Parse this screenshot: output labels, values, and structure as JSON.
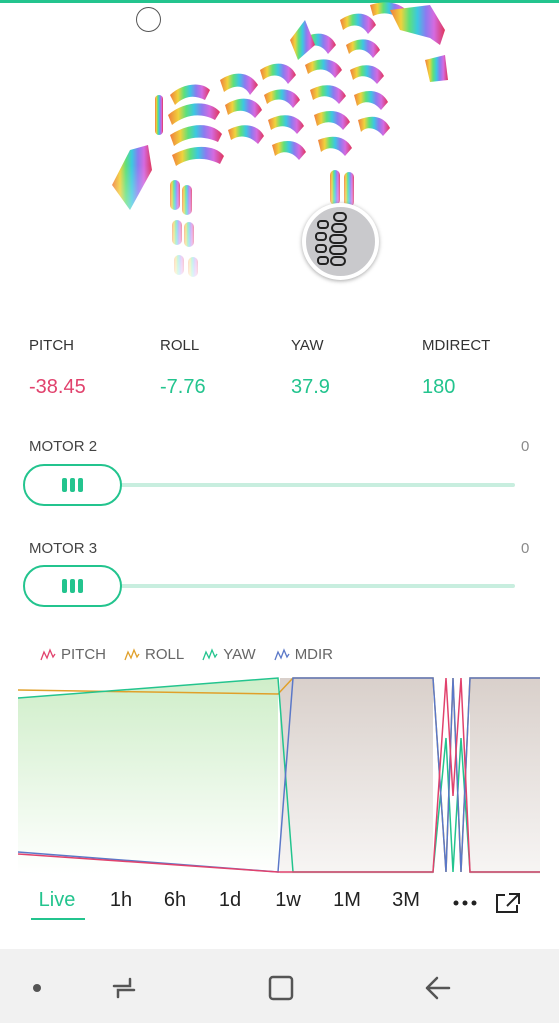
{
  "telemetry": [
    {
      "label": "PITCH",
      "value": "-38.45",
      "color": "#e1426d"
    },
    {
      "label": "ROLL",
      "value": "-7.76",
      "color": "#23c48e"
    },
    {
      "label": "YAW",
      "value": "37.9",
      "color": "#23c48e"
    },
    {
      "label": "MDIRECT",
      "value": "180",
      "color": "#23c48e"
    }
  ],
  "sliders": [
    {
      "label": "MOTOR 2",
      "value": "0",
      "level": 0
    },
    {
      "label": "MOTOR 3",
      "value": "0",
      "level": 0
    }
  ],
  "legend": [
    {
      "name": "PITCH",
      "color": "#e1426d"
    },
    {
      "name": "ROLL",
      "color": "#e0a02a"
    },
    {
      "name": "YAW",
      "color": "#23c48e"
    },
    {
      "name": "MDIR",
      "color": "#5b78c8"
    }
  ],
  "time_ranges": [
    "Live",
    "1h",
    "6h",
    "1d",
    "1w",
    "1M",
    "3M"
  ],
  "active_range": "Live",
  "icons": {
    "more": "more-dots-icon",
    "expand": "expand-icon",
    "home": "home-icon",
    "recents": "recents-icon",
    "back": "back-icon"
  },
  "colors": {
    "accent": "#23c48e",
    "pitch": "#e1426d",
    "roll": "#e0a02a",
    "yaw": "#23c48e",
    "mdir": "#5b78c8"
  }
}
